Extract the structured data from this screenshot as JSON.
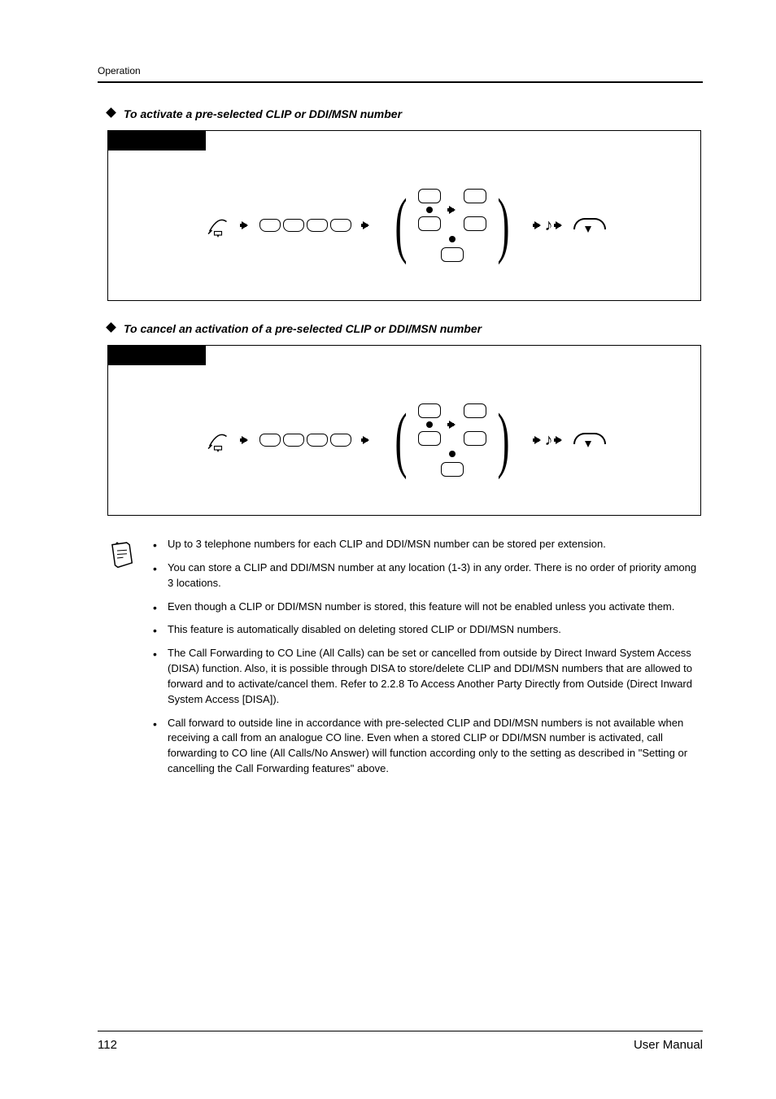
{
  "running_head": "Operation",
  "section_a": {
    "title": "To activate a pre-selected CLIP or DDI/MSN number"
  },
  "section_b": {
    "title": "To cancel an activation of a pre-selected CLIP or DDI/MSN number"
  },
  "notes": {
    "items": [
      "Up to 3 telephone numbers for each CLIP and DDI/MSN number can be stored per extension.",
      "You can store a CLIP and DDI/MSN number at any location (1-3) in any order. There is no order of priority among 3 locations.",
      "Even though a CLIP or DDI/MSN number is stored, this feature will not be enabled unless you activate them.",
      "This feature is automatically disabled on deleting stored CLIP or DDI/MSN numbers.",
      "The Call Forwarding to CO Line (All Calls) can be set or cancelled from outside by Direct Inward System Access (DISA) function. Also, it is possible through DISA to store/delete CLIP and DDI/MSN numbers that are allowed to forward and to activate/cancel them. Refer to 2.2.8   To Access Another Party Directly from Outside (Direct Inward System Access [DISA]).",
      "Call forward to outside line in accordance with pre-selected CLIP and DDI/MSN numbers is not available when receiving a call from an analogue CO line. Even when a stored CLIP or DDI/MSN number is activated, call forwarding to CO line (All Calls/No Answer) will function according only to the setting as described in \"Setting or cancelling the Call Forwarding features\" above."
    ]
  },
  "footer": {
    "page": "112",
    "label": "User Manual"
  }
}
